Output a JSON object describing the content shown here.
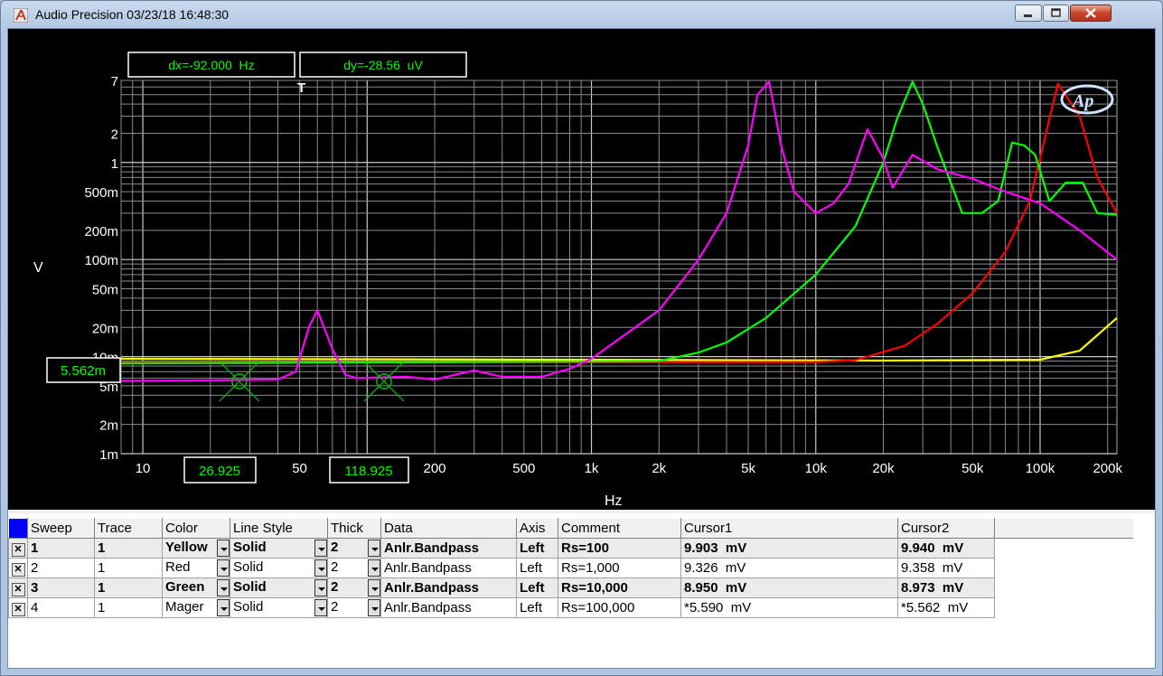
{
  "window": {
    "title": "Audio Precision  03/23/18 16:48:30",
    "controls": [
      "minimize",
      "maximize",
      "close"
    ]
  },
  "cursor_readouts": {
    "dx": "dx=-92.000  Hz",
    "dy": "dy=-28.56  uV",
    "y_value": "5.562m",
    "x1_value": "26.925",
    "x2_value": "118.925"
  },
  "chart_data": {
    "type": "line",
    "xscale": "log",
    "yscale": "log",
    "xlabel": "Hz",
    "ylabel": "V",
    "xlim": [
      8,
      220000
    ],
    "ylim": [
      0.001,
      7
    ],
    "grid": true,
    "xticks": [
      10,
      20,
      50,
      100,
      200,
      500,
      1000,
      2000,
      5000,
      10000,
      20000,
      50000,
      100000,
      200000
    ],
    "xtick_labels": [
      "10",
      "20",
      "50",
      "100",
      "200",
      "500",
      "1k",
      "2k",
      "5k",
      "10k",
      "20k",
      "50k",
      "100k",
      "200k"
    ],
    "yticks": [
      0.001,
      0.002,
      0.005,
      0.01,
      0.02,
      0.05,
      0.1,
      0.2,
      0.5,
      1,
      2,
      7
    ],
    "ytick_labels": [
      "1m",
      "2m",
      "5m",
      "10m",
      "20m",
      "50m",
      "100m",
      "200m",
      "500m",
      "1",
      "2",
      "7"
    ],
    "logo": "Ap",
    "series": [
      {
        "name": "1",
        "color": "#ffff00",
        "points": [
          [
            8,
            0.0095
          ],
          [
            1000,
            0.0093
          ],
          [
            20000,
            0.0091
          ],
          [
            100000,
            0.0093
          ],
          [
            150000,
            0.0115
          ],
          [
            220000,
            0.025
          ]
        ]
      },
      {
        "name": "2",
        "color": "#ff0000",
        "points": [
          [
            8,
            0.0087
          ],
          [
            5000,
            0.0088
          ],
          [
            10000,
            0.0088
          ],
          [
            15000,
            0.0092
          ],
          [
            25000,
            0.013
          ],
          [
            35000,
            0.022
          ],
          [
            50000,
            0.045
          ],
          [
            70000,
            0.12
          ],
          [
            90000,
            0.4
          ],
          [
            120000,
            6.5
          ],
          [
            150000,
            3.0
          ],
          [
            180000,
            0.7
          ],
          [
            220000,
            0.3
          ]
        ]
      },
      {
        "name": "3",
        "color": "#00ff00",
        "points": [
          [
            8,
            0.0085
          ],
          [
            30,
            0.0086
          ],
          [
            200,
            0.0088
          ],
          [
            1000,
            0.0089
          ],
          [
            2000,
            0.009
          ],
          [
            3000,
            0.011
          ],
          [
            4000,
            0.014
          ],
          [
            6000,
            0.025
          ],
          [
            10000,
            0.07
          ],
          [
            15000,
            0.22
          ],
          [
            20000,
            1.0
          ],
          [
            23000,
            2.8
          ],
          [
            27000,
            6.8
          ],
          [
            30000,
            4.0
          ],
          [
            35000,
            1.4
          ],
          [
            45000,
            0.3
          ],
          [
            55000,
            0.3
          ],
          [
            65000,
            0.4
          ],
          [
            75000,
            1.6
          ],
          [
            85000,
            1.5
          ],
          [
            95000,
            1.2
          ],
          [
            110000,
            0.4
          ],
          [
            130000,
            0.62
          ],
          [
            155000,
            0.62
          ],
          [
            180000,
            0.3
          ],
          [
            220000,
            0.29
          ]
        ]
      },
      {
        "name": "4",
        "color": "#ff00ff",
        "points": [
          [
            8,
            0.0056
          ],
          [
            20,
            0.0057
          ],
          [
            40,
            0.0058
          ],
          [
            48,
            0.007
          ],
          [
            55,
            0.02
          ],
          [
            60,
            0.03
          ],
          [
            70,
            0.012
          ],
          [
            80,
            0.0065
          ],
          [
            90,
            0.006
          ],
          [
            150,
            0.0062
          ],
          [
            200,
            0.0058
          ],
          [
            300,
            0.0072
          ],
          [
            400,
            0.0062
          ],
          [
            600,
            0.0062
          ],
          [
            800,
            0.0075
          ],
          [
            1000,
            0.0095
          ],
          [
            2000,
            0.03
          ],
          [
            3000,
            0.1
          ],
          [
            4000,
            0.3
          ],
          [
            5000,
            1.5
          ],
          [
            5500,
            5.0
          ],
          [
            6200,
            6.8
          ],
          [
            7000,
            1.5
          ],
          [
            8000,
            0.5
          ],
          [
            10000,
            0.3
          ],
          [
            12000,
            0.38
          ],
          [
            14000,
            0.6
          ],
          [
            17000,
            2.2
          ],
          [
            20000,
            1.1
          ],
          [
            22000,
            0.55
          ],
          [
            27000,
            1.2
          ],
          [
            35000,
            0.85
          ],
          [
            50000,
            0.68
          ],
          [
            70000,
            0.5
          ],
          [
            100000,
            0.38
          ],
          [
            150000,
            0.2
          ],
          [
            220000,
            0.1
          ]
        ]
      }
    ]
  },
  "table": {
    "headers": [
      "Sweep",
      "Trace",
      "Color",
      "Line Style",
      "Thick",
      "Data",
      "Axis",
      "Comment",
      "Cursor1",
      "Cursor2"
    ],
    "rows": [
      {
        "checked": "✕",
        "sweep": "1",
        "trace": "1",
        "color": "Yellow",
        "line_style": "Solid",
        "thick": "2",
        "data": "Anlr.Bandpass",
        "axis": "Left",
        "comment": "Rs=100",
        "cursor1": "9.903  mV",
        "cursor2": "9.940  mV",
        "bold": true
      },
      {
        "checked": "✕",
        "sweep": "2",
        "trace": "1",
        "color": "Red",
        "line_style": "Solid",
        "thick": "2",
        "data": "Anlr.Bandpass",
        "axis": "Left",
        "comment": "Rs=1,000",
        "cursor1": "9.326  mV",
        "cursor2": "9.358  mV",
        "bold": false
      },
      {
        "checked": "✕",
        "sweep": "3",
        "trace": "1",
        "color": "Green",
        "line_style": "Solid",
        "thick": "2",
        "data": "Anlr.Bandpass",
        "axis": "Left",
        "comment": "Rs=10,000",
        "cursor1": "8.950  mV",
        "cursor2": "8.973  mV",
        "bold": true
      },
      {
        "checked": "✕",
        "sweep": "4",
        "trace": "1",
        "color": "Mager",
        "line_style": "Solid",
        "thick": "2",
        "data": "Anlr.Bandpass",
        "axis": "Left",
        "comment": "Rs=100,000",
        "cursor1": "*5.590  mV",
        "cursor2": "*5.562  mV",
        "bold": false
      }
    ]
  }
}
